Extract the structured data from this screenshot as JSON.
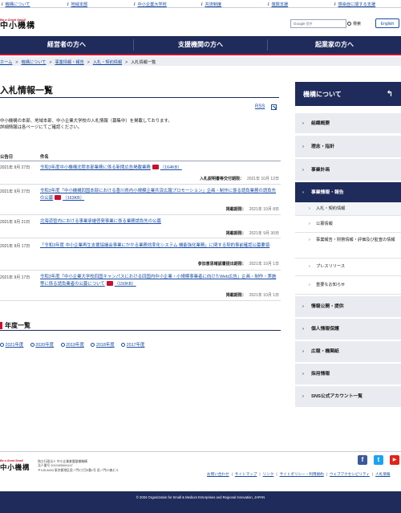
{
  "topbar": {
    "links": [
      "機構について",
      "地域本部",
      "中小企業大学校",
      "共済制度",
      "復興支援",
      "感染症に関する支援"
    ]
  },
  "header": {
    "logo_tagline": "Be a Great Small",
    "logo_name": "中小機構",
    "search_google": "Google",
    "search_hint": "提供",
    "search_button": "検索",
    "english_button": "English"
  },
  "mainnav": {
    "items": [
      "経営者の方へ",
      "支援機関の方へ",
      "起業家の方へ"
    ]
  },
  "breadcrumb": {
    "items": [
      "ホーム",
      "機構について",
      "事業情報・報告",
      "入札・契約情報"
    ],
    "current": "入札情報一覧"
  },
  "page": {
    "title": "入札情報一覧",
    "rss_label": "RSS",
    "intro_line1": "中小機構の本部、地域本部、中小企業大学校の入札情報（募集中）を掲載しております。",
    "intro_line2": "詳細情報は各ページにてご確認ください。"
  },
  "table": {
    "headers": [
      "公告日",
      "件名"
    ],
    "rows": [
      {
        "date": "2021年 9月 27日",
        "title": "令和3年度中小機構北陸本部業務に係る新聞広告掲載業務",
        "size": "（164KB）",
        "meta_label": "入札説明書等交付期限：",
        "meta_value": "2021年 10月 12日"
      },
      {
        "date": "2021年 9月 27日",
        "title": "令和3年度「中小機構四国本部における香川県内小規模企業共済広報プロモーション」企画・制作に係る請負業務の請負先の公募",
        "size": "（163KB）",
        "meta_label": "掲載期限：",
        "meta_value": "2021年 10月 8日"
      },
      {
        "date": "2021年 9月 21日",
        "title": "北海道管内における事業承継啓発事業に係る業務請負先の公募",
        "size": "",
        "meta_label": "掲載期限：",
        "meta_value": "2021年 9月 30日"
      },
      {
        "date": "2021年 9月 17日",
        "title": "「令和3年度 中小企業再生支援協議会事業にかかる業務効率化システム 機能強化業務」に関する契約事前確認公募要領",
        "size": "",
        "meta_label": "参加意思確認書提出期限：",
        "meta_value": "2021年 10月 1日"
      },
      {
        "date": "2021年 9月 17日",
        "title": "令和3年度「中小企業大学校四国キャンパスにおける四国内中小企業・小規模事業者に向けたWeb広告」企画・制作・実施等に係る請負業者の公募について",
        "size": "（150KB）",
        "meta_label": "掲載期限：",
        "meta_value": "2021年 10月 1日"
      }
    ]
  },
  "years": {
    "heading": "年度一覧",
    "items": [
      "2021年度",
      "2020年度",
      "2019年度",
      "2018年度",
      "2017年度"
    ]
  },
  "sidebar": {
    "title": "機構について",
    "items": [
      {
        "label": "組織概要"
      },
      {
        "label": "理念・指針"
      },
      {
        "label": "事業計画"
      },
      {
        "label": "事業情報・報告"
      },
      {
        "label": "情報公開・提供"
      },
      {
        "label": "個人情報保護"
      },
      {
        "label": "広報・機関紙"
      },
      {
        "label": "採用情報"
      },
      {
        "label": "SNS公式アカウント一覧"
      }
    ],
    "subitems": [
      "入札・契約情報",
      "公募情報",
      "事業報告・財務情報・評価及び監査の情報",
      "プレスリリース",
      "重要なお知らせ"
    ]
  },
  "footer": {
    "logo_tagline": "Be a Great Small",
    "logo_name": "中小機構",
    "org_name": "独立行政法人 中小企業基盤整備機構",
    "corp_no": "法人番号 2010405004147",
    "address": "〒105-8453 東京都港区虎ノ門3丁目5番1号 虎ノ門37森ビル",
    "social": [
      "f",
      "t",
      "▶"
    ],
    "links": [
      "お問い合わせ",
      "サイトマップ",
      "リンク",
      "サイトポリシー・利用規約",
      "ウェブアクセシビリティ",
      "人札情報"
    ],
    "copyright": "© 2004 Organization for Small & Medium Enterprises and Regional Innovation, JAPAN"
  },
  "colors": {
    "navy": "#1f2b5b",
    "accent_red": "#c8102e",
    "link_blue": "#1a4ea3",
    "sidebar_bg": "#e9ebf0"
  }
}
